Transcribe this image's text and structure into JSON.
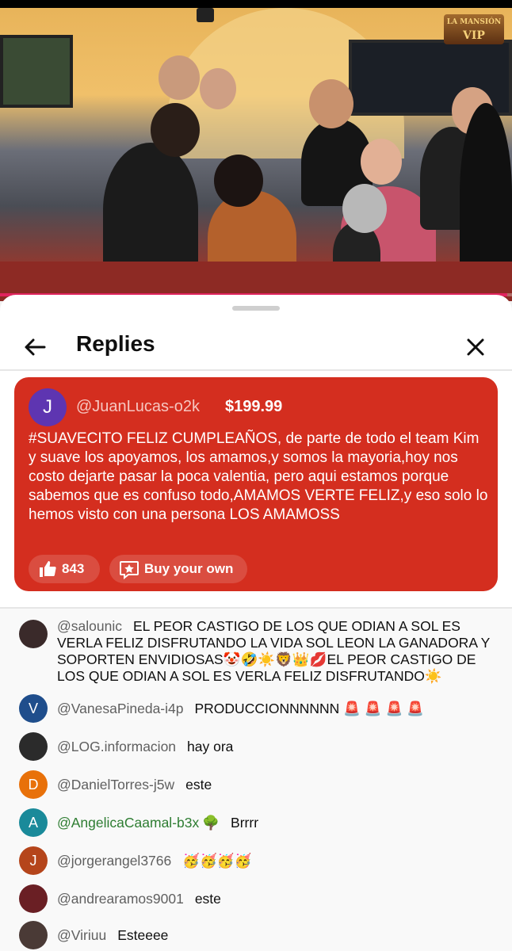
{
  "video": {
    "logo_line1": "LA MANSIÓN",
    "logo_line2": "VIP",
    "progress": 0.99
  },
  "header": {
    "title": "Replies"
  },
  "super_chat": {
    "avatar_letter": "J",
    "avatar_color": "#5e35b1",
    "username": "@JuanLucas-o2k",
    "amount": "$199.99",
    "message": "#SUAVECITO FELIZ CUMPLEAÑOS, de parte de todo el team Kim y suave los apoyamos, los amamos,y somos la mayoria,hoy nos costo dejarte pasar la poca valentia, pero aqui estamos porque sabemos que es confuso todo,AMAMOS VERTE FELIZ,y eso solo lo hemos visto con una persona LOS AMAMOSS",
    "likes": "843",
    "buy_label": "Buy your own",
    "background": "#d42e1f"
  },
  "comments": [
    {
      "username": "@salounic",
      "avatar_type": "photo",
      "avatar_color": "#3a2a2a",
      "text": "EL PEOR CASTIGO DE LOS QUE ODIAN A SOL ES VERLA FELIZ DISFRUTANDO LA VIDA SOL LEON LA GANADORA Y SOPORTEN ENVIDIOSAS🤡🤣☀️🦁👑💋EL PEOR CASTIGO DE LOS QUE ODIAN A SOL ES VERLA FELIZ DISFRUTANDO☀️"
    },
    {
      "username": "@VanesaPineda-i4p",
      "avatar_letter": "V",
      "avatar_color": "#1f4e8c",
      "text": "PRODUCCIONNNNNN 🚨 🚨 🚨 🚨"
    },
    {
      "username": "@LOG.informacion",
      "avatar_type": "photo",
      "avatar_color": "#2b2b2b",
      "text": "hay ora"
    },
    {
      "username": "@DanielTorres-j5w",
      "avatar_letter": "D",
      "avatar_color": "#e8710a",
      "text": "este"
    },
    {
      "username": "@AngelicaCaamal-b3x",
      "avatar_letter": "A",
      "avatar_color": "#1a8a9a",
      "member": true,
      "badge": "🌳",
      "text": "Brrrr"
    },
    {
      "username": "@jorgerangel3766",
      "avatar_letter": "J",
      "avatar_color": "#b5451b",
      "text": "🥳🥳🥳🥳"
    },
    {
      "username": "@andrearamos9001",
      "avatar_type": "photo",
      "avatar_color": "#6a1f24",
      "text": "este"
    },
    {
      "username": "@Viriuu",
      "avatar_type": "photo",
      "avatar_color": "#4a3a36",
      "text": "Esteeee"
    }
  ]
}
